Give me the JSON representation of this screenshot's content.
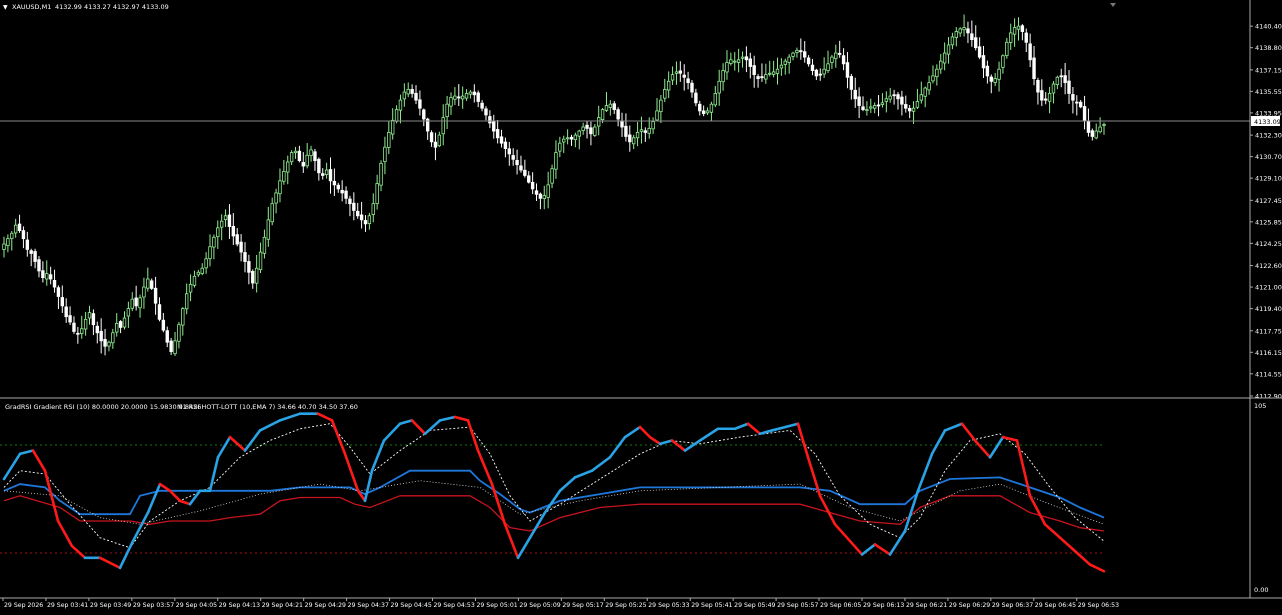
{
  "price_panel": {
    "symbol_label": "XAUUSD,M1",
    "ohlc_label": "4132.99 4133.27 4132.97 4133.09",
    "current_price_label": "4133.09",
    "current_price": 4133.09
  },
  "indicator_panel": {
    "title": "GradRSI Gradient RSI (10) 80.0000 20.0000 15.9830 9.8426",
    "subtitle": "M1 RSI HOTT-LOTT (10,EMA 7) 34.66 40.70 34.50 37.60",
    "scale_top": "105",
    "scale_bottom": "0.00"
  },
  "colors": {
    "background": "#000000",
    "bull_candle": "#90EE90",
    "bear_candle": "#FFFFFF",
    "grid_text": "#FFFFFF",
    "rsi_rising": "#29A3E5",
    "rsi_falling": "#FF1A1A",
    "hott_line": "#1E78DC",
    "lott_line": "#C8141E",
    "dotted_line": "#FFFFFF",
    "level_upper": "#0F7A0F",
    "level_lower": "#A01010"
  },
  "chart_data": [
    {
      "type": "candlestick",
      "title": "XAUUSD,M1",
      "ylim": [
        4112.9,
        4141.9
      ],
      "y_ticks": [
        "4140.40",
        "4138.80",
        "4137.15",
        "4135.55",
        "4133.95",
        "4132.30",
        "4130.70",
        "4129.10",
        "4127.45",
        "4125.85",
        "4124.25",
        "4122.60",
        "4121.00",
        "4119.40",
        "4117.75",
        "4116.15",
        "4114.55",
        "4112.90"
      ],
      "close_series": [
        4124.2,
        4124.6,
        4125.0,
        4125.6,
        4125.2,
        4124.6,
        4123.8,
        4123.5,
        4122.9,
        4122.2,
        4121.7,
        4122.0,
        4121.6,
        4121.0,
        4120.3,
        4119.6,
        4118.8,
        4118.4,
        4117.7,
        4117.5,
        4117.9,
        4118.6,
        4119.1,
        4118.2,
        4117.6,
        4117.0,
        4116.6,
        4116.9,
        4117.6,
        4118.3,
        4118.0,
        4118.7,
        4119.4,
        4120.1,
        4119.6,
        4120.2,
        4121.0,
        4121.6,
        4120.9,
        4119.8,
        4118.6,
        4117.8,
        4116.9,
        4116.2,
        4117.0,
        4118.2,
        4119.4,
        4120.5,
        4121.2,
        4121.8,
        4122.1,
        4122.4,
        4123.1,
        4124.0,
        4124.7,
        4125.4,
        4125.9,
        4126.3,
        4125.5,
        4124.8,
        4124.2,
        4123.6,
        4122.9,
        4122.1,
        4121.3,
        4122.4,
        4123.6,
        4124.7,
        4126.0,
        4127.2,
        4128.0,
        4128.9,
        4129.6,
        4130.3,
        4131.0,
        4131.1,
        4130.4,
        4130.0,
        4130.8,
        4131.2,
        4130.4,
        4129.5,
        4129.3,
        4129.7,
        4128.9,
        4128.6,
        4128.3,
        4128.0,
        4127.6,
        4127.2,
        4126.7,
        4126.3,
        4126.0,
        4125.7,
        4126.3,
        4127.2,
        4128.7,
        4130.2,
        4131.4,
        4132.5,
        4133.4,
        4134.2,
        4134.9,
        4135.5,
        4135.7,
        4135.4,
        4134.9,
        4134.3,
        4133.5,
        4132.6,
        4131.8,
        4131.4,
        4132.3,
        4133.6,
        4134.6,
        4135.1,
        4135.2,
        4135.1,
        4135.2,
        4135.4,
        4135.5,
        4135.3,
        4134.8,
        4134.3,
        4133.8,
        4133.2,
        4132.6,
        4132.1,
        4131.7,
        4131.3,
        4130.9,
        4130.5,
        4130.1,
        4129.7,
        4129.3,
        4128.8,
        4128.3,
        4127.9,
        4127.6,
        4127.8,
        4128.6,
        4129.8,
        4131.0,
        4131.7,
        4132.0,
        4132.1,
        4132.0,
        4132.3,
        4132.6,
        4132.9,
        4132.8,
        4132.4,
        4132.9,
        4133.6,
        4134.2,
        4134.5,
        4134.6,
        4134.2,
        4133.5,
        4132.9,
        4132.2,
        4131.8,
        4132.1,
        4132.5,
        4132.7,
        4132.5,
        4132.8,
        4133.3,
        4134.1,
        4134.9,
        4135.7,
        4136.3,
        4136.8,
        4137.0,
        4136.9,
        4136.6,
        4136.2,
        4135.5,
        4134.7,
        4134.1,
        4133.9,
        4134.1,
        4134.6,
        4135.4,
        4136.3,
        4137.1,
        4137.7,
        4137.9,
        4137.8,
        4137.9,
        4138.1,
        4137.9,
        4137.4,
        4136.8,
        4136.5,
        4136.6,
        4136.8,
        4136.9,
        4137.0,
        4137.2,
        4137.5,
        4137.8,
        4138.1,
        4138.4,
        4138.6,
        4138.5,
        4138.1,
        4137.6,
        4137.1,
        4136.7,
        4136.8,
        4137.2,
        4137.6,
        4138.1,
        4138.4,
        4138.3,
        4137.6,
        4136.6,
        4135.7,
        4135.0,
        4134.5,
        4134.2,
        4134.2,
        4134.4,
        4134.5,
        4134.5,
        4134.7,
        4135.0,
        4135.2,
        4135.3,
        4135.0,
        4134.6,
        4134.3,
        4134.1,
        4134.3,
        4134.8,
        4135.3,
        4135.8,
        4136.2,
        4136.7,
        4137.2,
        4137.8,
        4138.4,
        4139.0,
        4139.6,
        4140.0,
        4140.2,
        4140.3,
        4139.9,
        4139.4,
        4138.8,
        4138.1,
        4137.3,
        4136.7,
        4136.3,
        4136.5,
        4137.2,
        4138.2,
        4139.2,
        4139.9,
        4140.3,
        4140.4,
        4140.0,
        4139.2,
        4137.9,
        4136.5,
        4135.5,
        4134.9,
        4134.9,
        4135.4,
        4136.1,
        4136.6,
        4136.7,
        4136.2,
        4135.4,
        4134.9,
        4134.7,
        4134.4,
        4133.4,
        4132.5,
        4132.2,
        4132.6,
        4132.9,
        4133.09
      ]
    },
    {
      "type": "line",
      "title": "GradRSI Gradient RSI (10) 80.0000 20.0000 15.9830 9.8426",
      "ylim": [
        0,
        105
      ],
      "levels": [
        80,
        20
      ],
      "series_values_latest": {
        "RSI": 34.66,
        "HOTT": 40.7,
        "LOTT": 34.5,
        "EMA": 37.6
      }
    }
  ],
  "time_axis": {
    "labels": [
      "29 Sep 2026",
      "29 Sep 03:41",
      "29 Sep 03:49",
      "29 Sep 03:57",
      "29 Sep 04:05",
      "29 Sep 04:13",
      "29 Sep 04:21",
      "29 Sep 04:29",
      "29 Sep 04:37",
      "29 Sep 04:45",
      "29 Sep 04:53",
      "29 Sep 05:01",
      "29 Sep 05:09",
      "29 Sep 05:17",
      "29 Sep 05:25",
      "29 Sep 05:33",
      "29 Sep 05:41",
      "29 Sep 05:49",
      "29 Sep 05:57",
      "29 Sep 06:05",
      "29 Sep 06:13",
      "29 Sep 06:21",
      "29 Sep 06:29",
      "29 Sep 06:37",
      "29 Sep 06:45",
      "29 Sep 06:53"
    ]
  }
}
